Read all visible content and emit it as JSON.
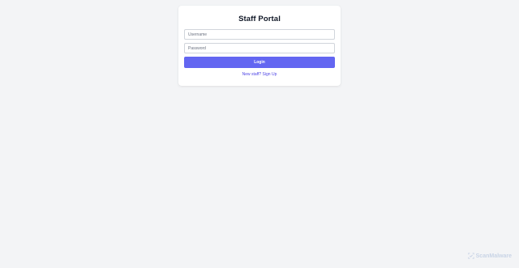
{
  "login": {
    "title": "Staff Portal",
    "username_placeholder": "Username",
    "password_placeholder": "Password",
    "login_label": "Login",
    "signup_label": "New staff? Sign Up"
  },
  "watermark": {
    "text": "ScanMalware",
    "icon": "scanmalware-logo-icon",
    "color": "#c9d4e6"
  },
  "colors": {
    "background": "#f3f4f6",
    "card": "#ffffff",
    "accent": "#6366f1",
    "link": "#4f46e5"
  }
}
